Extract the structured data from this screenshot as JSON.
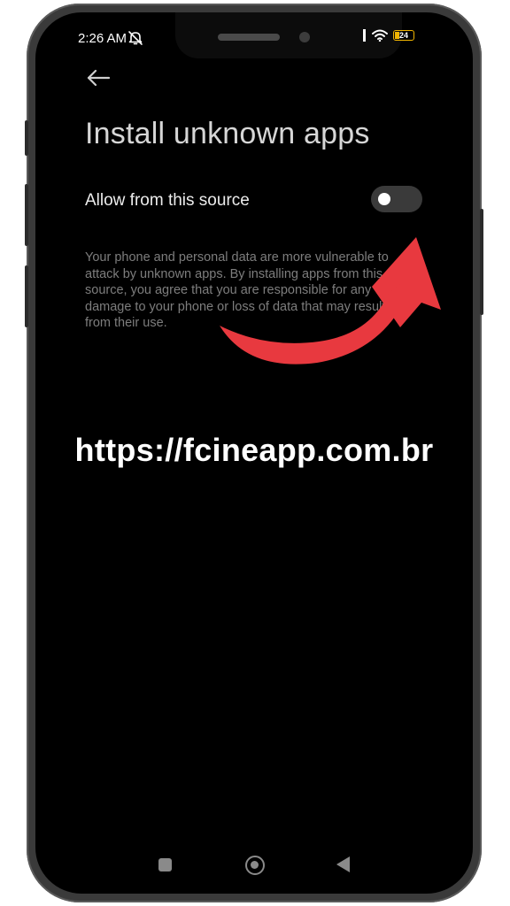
{
  "status_bar": {
    "time": "2:26 AM",
    "battery_level": "24",
    "icons": [
      "mute-icon",
      "signal-icon",
      "wifi-icon",
      "battery-icon"
    ]
  },
  "header": {
    "back_icon": "back-arrow-icon",
    "title": "Install unknown apps"
  },
  "setting": {
    "label": "Allow from this source",
    "toggle_state": "off"
  },
  "description": "Your phone and personal data are more vulnerable to attack by unknown apps. By installing apps from this source, you agree that you are responsible for any damage to your phone or loss of data that may result from their use.",
  "overlay": {
    "url_text": "https://fcineapp.com.br",
    "arrow_color": "#e8393f",
    "arrow_icon": "curved-arrow-icon"
  },
  "nav_bar": {
    "items": [
      "recents-icon",
      "home-icon",
      "back-icon"
    ]
  },
  "colors": {
    "background": "#000000",
    "battery_accent": "#f0b400",
    "toggle_track": "#3a3a3a"
  }
}
